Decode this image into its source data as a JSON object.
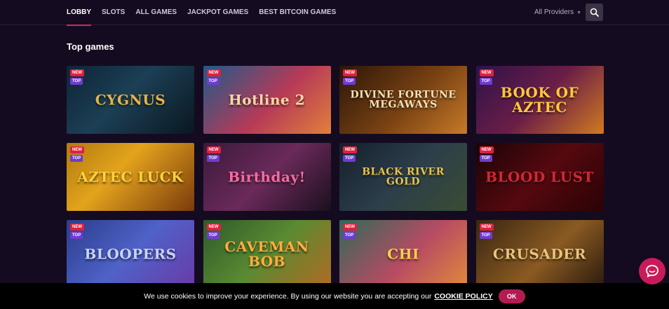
{
  "nav": {
    "items": [
      {
        "label": "LOBBY",
        "active": true
      },
      {
        "label": "SLOTS",
        "active": false
      },
      {
        "label": "ALL GAMES",
        "active": false
      },
      {
        "label": "JACKPOT GAMES",
        "active": false
      },
      {
        "label": "BEST BITCOIN GAMES",
        "active": false
      }
    ],
    "providers_label": "All Providers",
    "providers_caret_icon": "caret-down-icon",
    "search_icon": "search-icon"
  },
  "section": {
    "title": "Top games"
  },
  "badges": {
    "new": "NEW",
    "top": "TOP"
  },
  "games": [
    {
      "title": "CYGNUS",
      "bg": "linear-gradient(135deg,#0e2436 0%,#1c3f55 45%,#0a1720 100%)",
      "fg": "#e3b349"
    },
    {
      "title": "Hotline 2",
      "bg": "linear-gradient(135deg,#1f5a8a 0%,#b73a57 55%,#e0803c 100%)",
      "fg": "#ffd6a8"
    },
    {
      "title": "DIVINE FORTUNE MEGAWAYS",
      "bg": "linear-gradient(135deg,#2a1609 0%,#7a4213 55%,#c77a28 100%)",
      "fg": "#f5e2b8"
    },
    {
      "title": "BOOK OF AZTEC",
      "bg": "linear-gradient(135deg,#2d124a 0%,#6b1e47 50%,#d17a1f 100%)",
      "fg": "#ffc93a"
    },
    {
      "title": "AZTEC LUCK",
      "bg": "linear-gradient(135deg,#b07a10 0%,#e3a31c 40%,#7a3a0c 100%)",
      "fg": "#ffd23a"
    },
    {
      "title": "Birthday!",
      "bg": "linear-gradient(135deg,#3b1a3b 0%,#6a2a5a 50%,#1b0f1e 100%)",
      "fg": "#ff6aa0"
    },
    {
      "title": "BLACK RIVER GOLD",
      "bg": "linear-gradient(135deg,#14202c 0%,#2c3e4a 50%,#3a4c34 100%)",
      "fg": "#e8c34a"
    },
    {
      "title": "BLOOD LUST",
      "bg": "linear-gradient(135deg,#1a0406 0%,#55090f 50%,#2a0205 100%)",
      "fg": "#d22734"
    },
    {
      "title": "BLOOPERS",
      "bg": "linear-gradient(135deg,#2b3d8a 0%,#4f62c8 50%,#6a3aa8 100%)",
      "fg": "#c6d4ff"
    },
    {
      "title": "CAVEMAN BOB",
      "bg": "linear-gradient(135deg,#2e5a2a 0%,#5a8a32 50%,#b36a22 100%)",
      "fg": "#ffae3a"
    },
    {
      "title": "CHI",
      "bg": "linear-gradient(135deg,#2f6a58 0%,#b74b63 55%,#e08a3a 100%)",
      "fg": "#ffd04a"
    },
    {
      "title": "CRUSADER",
      "bg": "linear-gradient(135deg,#3a2612 0%,#8a5a22 55%,#2a1a0e 100%)",
      "fg": "#e7c27a"
    }
  ],
  "cookie": {
    "text": "We use cookies to improve your experience. By using our website you are accepting our",
    "link": "COOKIE POLICY",
    "ok": "OK"
  },
  "chat": {
    "icon": "chat-icon"
  }
}
